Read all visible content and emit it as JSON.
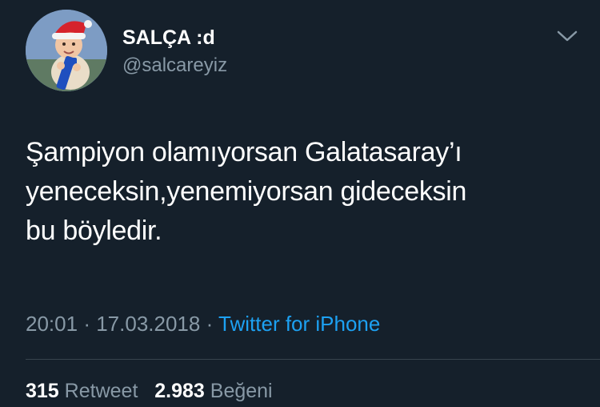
{
  "tweet": {
    "user": {
      "display_name": "SALÇA :d",
      "handle": "@salcareyiz",
      "avatar_icon": "profile-photo-santa-hat-child"
    },
    "menu_icon": "chevron-down-icon",
    "text": "Şampiyon olamıyorsan Galatasaray’ı\nyeneceksin,yenemiyorsan gideceksin\nbu böyledir.",
    "time": "20:01",
    "date": "17.03.2018",
    "separator": "·",
    "source": "Twitter for iPhone",
    "stats": {
      "retweets_count": "315",
      "retweets_label": "Retweet",
      "likes_count": "2.983",
      "likes_label": "Beğeni"
    }
  },
  "colors": {
    "background": "#15202b",
    "primary_text": "#ffffff",
    "secondary_text": "#8899a6",
    "link": "#1da1f2",
    "divider": "#38444d"
  }
}
